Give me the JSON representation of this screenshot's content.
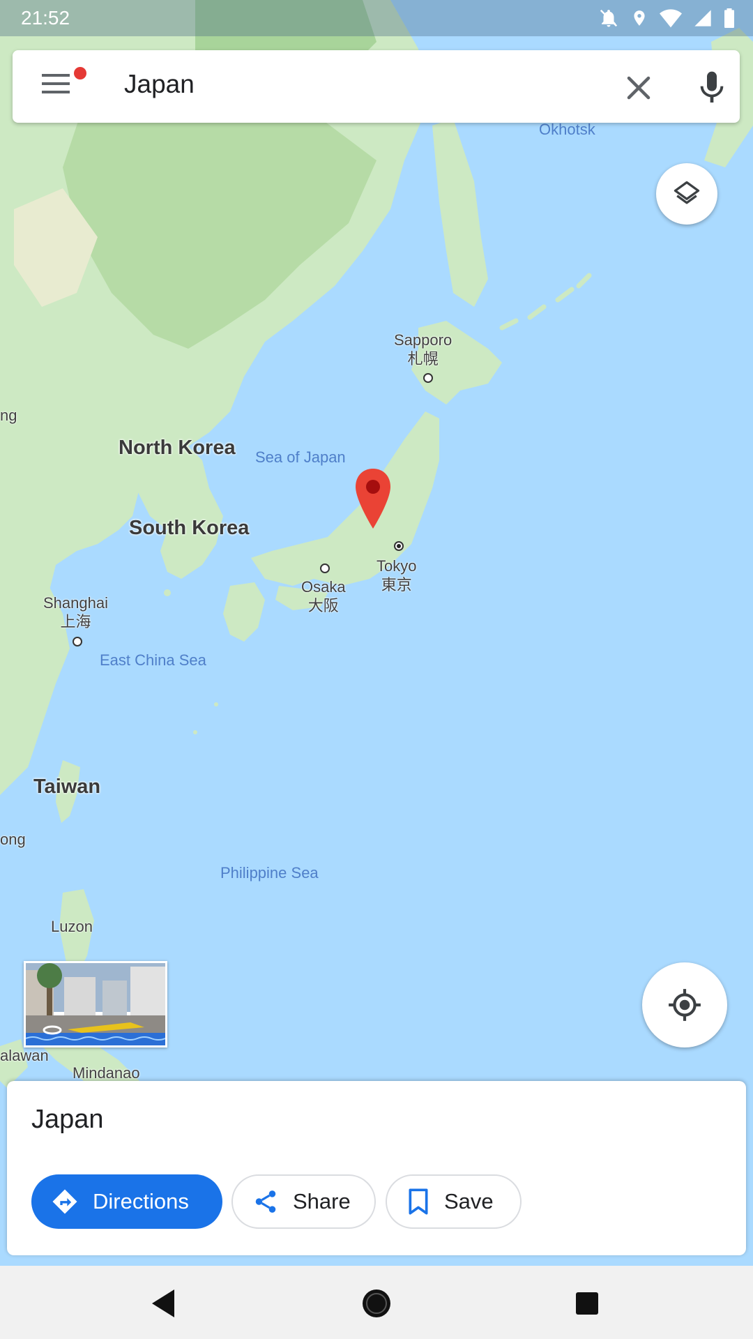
{
  "status_bar": {
    "time": "21:52",
    "icons": [
      "notifications-off-icon",
      "location-icon",
      "wifi-icon",
      "signal-icon",
      "battery-icon"
    ]
  },
  "search": {
    "query": "Japan",
    "menu_icon": "menu-icon",
    "has_notification": true,
    "clear_icon": "close-icon",
    "voice_icon": "mic-icon"
  },
  "map": {
    "countries": [
      "North Korea",
      "South Korea",
      "Taiwan"
    ],
    "seas": [
      "Sea of Japan",
      "East China Sea",
      "Philippine Sea",
      "Okhotsk"
    ],
    "regions": [
      "Luzon",
      "Mindanao",
      "alawan",
      "ng",
      "ong"
    ],
    "cities": [
      {
        "name": "Sapporo",
        "local": "札幌"
      },
      {
        "name": "Tokyo",
        "local": "東京"
      },
      {
        "name": "Osaka",
        "local": "大阪"
      },
      {
        "name": "Shanghai",
        "local": "上海"
      }
    ],
    "pin_icon": "map-pin-icon",
    "layers_icon": "layers-icon",
    "my_location_icon": "my-location-icon",
    "street_view_thumbnail": "street-view-thumbnail"
  },
  "place": {
    "title": "Japan",
    "actions": {
      "directions": "Directions",
      "share": "Share",
      "save": "Save"
    }
  },
  "nav_bar": {
    "back_icon": "back-icon",
    "home_icon": "home-icon",
    "recents_icon": "recents-icon"
  },
  "colors": {
    "water": "#aadaff",
    "land": "#cde9c3",
    "forest": "#b2d8a3",
    "accent": "#1a73e8",
    "pin": "#ea4335"
  }
}
